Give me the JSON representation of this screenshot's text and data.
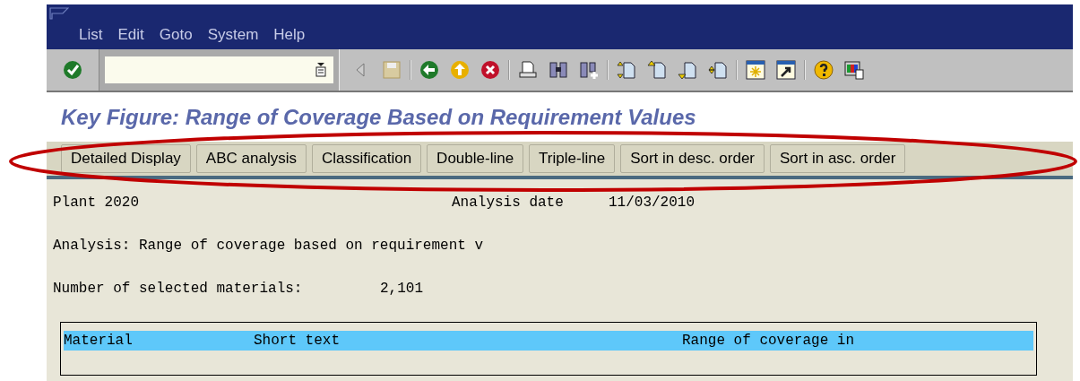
{
  "menu": [
    {
      "label": "List"
    },
    {
      "label": "Edit"
    },
    {
      "label": "Goto"
    },
    {
      "label": "System"
    },
    {
      "label": "Help"
    }
  ],
  "page_title": "Key Figure: Range of Coverage Based on Requirement Values",
  "app_buttons": [
    "Detailed Display",
    "ABC analysis",
    "Classification",
    "Double-line",
    "Triple-line",
    "Sort in desc. order",
    "Sort in asc. order"
  ],
  "report": {
    "plant": "Plant 2020",
    "analysis_date_label": "Analysis date",
    "analysis_date": "11/03/2010",
    "analysis": "Analysis: Range of coverage based on requirement v",
    "count_label": "Number of selected materials:",
    "count": "2,101"
  },
  "table": {
    "columns": [
      "Material",
      "Short text",
      "Range of coverage in"
    ]
  }
}
